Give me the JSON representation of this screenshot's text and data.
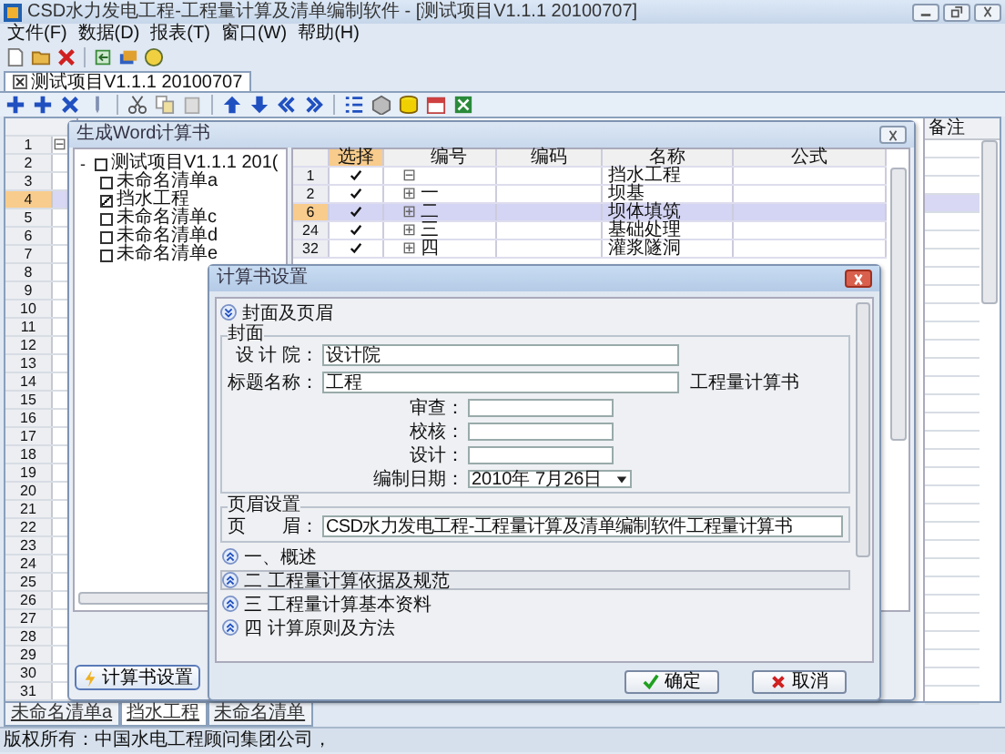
{
  "window": {
    "title": "CSD水力发电工程-工程量计算及清单编制软件 - [测试项目V1.1.1 20100707]"
  },
  "menu": [
    "文件(F)",
    "数据(D)",
    "报表(T)",
    "窗口(W)",
    "帮助(H)"
  ],
  "doc_tabs": [
    {
      "label": "测试项目V1.1.1 20100707",
      "selected": true
    }
  ],
  "main_grid": {
    "header": "备注",
    "rows": [
      {
        "label": "1",
        "selected": false,
        "toggle": "⊟"
      },
      {
        "label": "2",
        "selected": false
      },
      {
        "label": "3",
        "selected": false
      },
      {
        "label": "4",
        "selected": true
      },
      {
        "label": "5",
        "selected": false
      },
      {
        "label": "6",
        "selected": false
      },
      {
        "label": "7",
        "selected": false
      },
      {
        "label": "8",
        "selected": false
      },
      {
        "label": "9",
        "selected": false
      },
      {
        "label": "10",
        "selected": false
      },
      {
        "label": "11",
        "selected": false
      },
      {
        "label": "12",
        "selected": false
      },
      {
        "label": "13",
        "selected": false
      },
      {
        "label": "14",
        "selected": false
      },
      {
        "label": "15",
        "selected": false
      },
      {
        "label": "16",
        "selected": false
      },
      {
        "label": "17",
        "selected": false
      },
      {
        "label": "18",
        "selected": false
      },
      {
        "label": "19",
        "selected": false
      },
      {
        "label": "20",
        "selected": false
      },
      {
        "label": "21",
        "selected": false
      },
      {
        "label": "22",
        "selected": false
      },
      {
        "label": "23",
        "selected": false
      },
      {
        "label": "24",
        "selected": false
      },
      {
        "label": "25",
        "selected": false
      },
      {
        "label": "26",
        "selected": false
      },
      {
        "label": "27",
        "selected": false
      },
      {
        "label": "28",
        "selected": false
      },
      {
        "label": "29",
        "selected": false
      },
      {
        "label": "30",
        "selected": false
      },
      {
        "label": "31",
        "selected": false
      }
    ]
  },
  "word_dialog": {
    "title": "生成Word计算书",
    "tree": {
      "label": "测试项目V1.1.1 201(",
      "toggle": "-",
      "checked": false,
      "children": [
        {
          "label": "未命名清单a",
          "checked": false
        },
        {
          "label": "挡水工程",
          "checked": true
        },
        {
          "label": "未命名清单c",
          "checked": false
        },
        {
          "label": "未命名清单d",
          "checked": false
        },
        {
          "label": "未命名清单e",
          "checked": false
        }
      ]
    },
    "columns": [
      "选择",
      "编号",
      "编码",
      "名称",
      "公式"
    ],
    "rows": [
      {
        "index": "1",
        "checked": true,
        "toggle": "⊟",
        "name": "挡水工程",
        "selected": false
      },
      {
        "index": "2",
        "checked": true,
        "toggle": "⊞",
        "number": "一",
        "name": "坝基",
        "selected": false
      },
      {
        "index": "6",
        "checked": true,
        "toggle": "⊞",
        "number": "二",
        "name": "坝体填筑",
        "selected": true
      },
      {
        "index": "24",
        "checked": true,
        "toggle": "⊞",
        "number": "三",
        "name": "基础处理",
        "selected": false
      },
      {
        "index": "32",
        "checked": true,
        "toggle": "⊞",
        "number": "四",
        "name": "灌浆隧洞",
        "selected": false
      }
    ],
    "button": "计算书设置"
  },
  "settings_dialog": {
    "title": "计算书设置",
    "cover_section": {
      "label": "封面及页眉",
      "expanded": true
    },
    "cover_group": "封面",
    "fields": [
      {
        "label": "设 计 院：",
        "value": "设计院"
      },
      {
        "label": "标题名称：",
        "value": "工程",
        "suffix": "工程量计算书"
      }
    ],
    "sign_fields": [
      {
        "label": "审查："
      },
      {
        "label": "校核："
      },
      {
        "label": "设计："
      }
    ],
    "date": {
      "label": "编制日期：",
      "value": "2010年 7月26日"
    },
    "header_group": "页眉设置",
    "header_field": {
      "label": "页　　眉：",
      "value": "CSD水力发电工程-工程量计算及清单编制软件工程量计算书"
    },
    "sections": [
      {
        "label": "一、概述",
        "expanded": false,
        "selected": false
      },
      {
        "label": "二 工程量计算依据及规范",
        "expanded": false,
        "selected": true
      },
      {
        "label": "三 工程量计算基本资料",
        "expanded": false,
        "selected": false
      },
      {
        "label": "四 计算原则及方法",
        "expanded": false,
        "selected": false
      }
    ],
    "ok": "确定",
    "cancel": "取消"
  },
  "sheet_tabs": [
    {
      "label": "未命名清单a",
      "selected": false
    },
    {
      "label": "挡水工程",
      "selected": true
    },
    {
      "label": "未命名清单",
      "selected": false
    }
  ],
  "status": "版权所有：中国水电工程顾问集团公司，"
}
